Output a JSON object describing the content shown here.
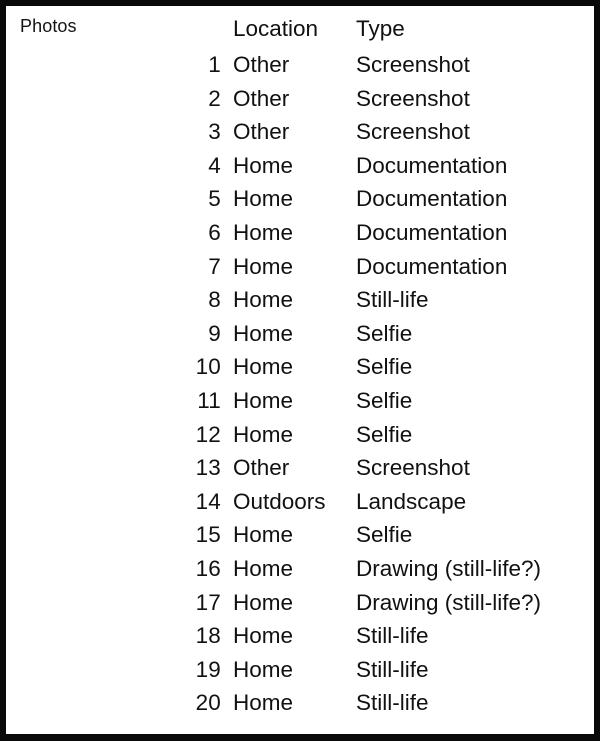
{
  "caption": "Photos",
  "table": {
    "headers": {
      "index": "",
      "location": "Location",
      "type": "Type"
    },
    "rows": [
      {
        "index": "1",
        "location": "Other",
        "type": "Screenshot"
      },
      {
        "index": "2",
        "location": "Other",
        "type": "Screenshot"
      },
      {
        "index": "3",
        "location": "Other",
        "type": "Screenshot"
      },
      {
        "index": "4",
        "location": "Home",
        "type": "Documentation"
      },
      {
        "index": "5",
        "location": "Home",
        "type": "Documentation"
      },
      {
        "index": "6",
        "location": "Home",
        "type": "Documentation"
      },
      {
        "index": "7",
        "location": "Home",
        "type": "Documentation"
      },
      {
        "index": "8",
        "location": "Home",
        "type": "Still-life"
      },
      {
        "index": "9",
        "location": "Home",
        "type": "Selfie"
      },
      {
        "index": "10",
        "location": "Home",
        "type": "Selfie"
      },
      {
        "index": "11",
        "location": "Home",
        "type": "Selfie"
      },
      {
        "index": "12",
        "location": "Home",
        "type": "Selfie"
      },
      {
        "index": "13",
        "location": "Other",
        "type": "Screenshot"
      },
      {
        "index": "14",
        "location": "Outdoors",
        "type": "Landscape"
      },
      {
        "index": "15",
        "location": "Home",
        "type": "Selfie"
      },
      {
        "index": "16",
        "location": "Home",
        "type": "Drawing (still-life?)"
      },
      {
        "index": "17",
        "location": "Home",
        "type": "Drawing (still-life?)"
      },
      {
        "index": "18",
        "location": "Home",
        "type": "Still-life"
      },
      {
        "index": "19",
        "location": "Home",
        "type": "Still-life"
      },
      {
        "index": "20",
        "location": "Home",
        "type": "Still-life"
      }
    ]
  },
  "colors": {
    "border": "#0a0a0a",
    "page": "#ffffff",
    "text": "#111111"
  }
}
